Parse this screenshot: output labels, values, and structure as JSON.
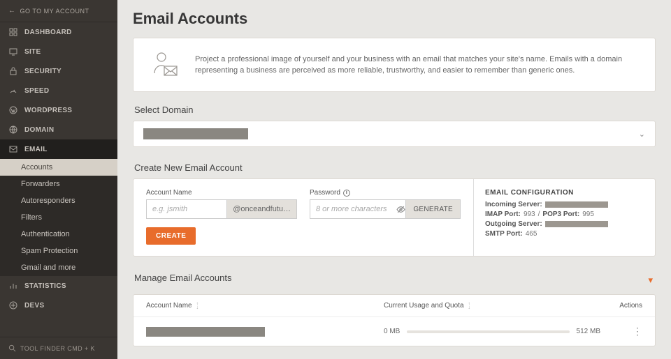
{
  "topbar": {
    "go_account": "GO TO MY ACCOUNT"
  },
  "sidebar": {
    "items": [
      {
        "label": "DASHBOARD",
        "icon": "grid"
      },
      {
        "label": "SITE",
        "icon": "monitor"
      },
      {
        "label": "SECURITY",
        "icon": "lock"
      },
      {
        "label": "SPEED",
        "icon": "gauge"
      },
      {
        "label": "WORDPRESS",
        "icon": "wp"
      },
      {
        "label": "DOMAIN",
        "icon": "globe"
      },
      {
        "label": "EMAIL",
        "icon": "mail",
        "active": true
      },
      {
        "label": "STATISTICS",
        "icon": "chart"
      },
      {
        "label": "DEVS",
        "icon": "plus"
      }
    ],
    "email_sub": [
      {
        "label": "Accounts",
        "selected": true
      },
      {
        "label": "Forwarders"
      },
      {
        "label": "Autoresponders"
      },
      {
        "label": "Filters"
      },
      {
        "label": "Authentication"
      },
      {
        "label": "Spam Protection"
      },
      {
        "label": "Gmail and more"
      }
    ],
    "footer": "TOOL FINDER CMD + K"
  },
  "page": {
    "title": "Email Accounts",
    "intro": "Project a professional image of yourself and your business with an email that matches your site's name. Emails with a domain representing a business are perceived as more reliable, trustworthy, and easier to remember than generic ones.",
    "select_domain_label": "Select Domain",
    "create_section": "Create New Email Account",
    "manage_section": "Manage Email Accounts"
  },
  "form": {
    "account_label": "Account Name",
    "account_placeholder": "e.g. jsmith",
    "domain_suffix": "@onceandfutu…",
    "password_label": "Password",
    "password_placeholder": "8 or more characters",
    "generate_btn": "GENERATE",
    "create_btn": "CREATE"
  },
  "config": {
    "heading": "EMAIL CONFIGURATION",
    "incoming_label": "Incoming Server:",
    "imap_label": "IMAP Port:",
    "imap_port": "993",
    "pop3_label": "POP3 Port:",
    "pop3_port": "995",
    "outgoing_label": "Outgoing Server:",
    "smtp_label": "SMTP Port:",
    "smtp_port": "465"
  },
  "table": {
    "col_name": "Account Name",
    "col_usage": "Current Usage and Quota",
    "col_actions": "Actions",
    "row0": {
      "usage": "0 MB",
      "quota": "512 MB"
    }
  }
}
